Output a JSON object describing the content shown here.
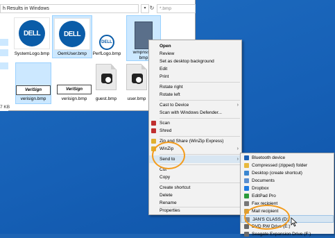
{
  "explorer": {
    "address": "h Results in Windows",
    "search_placeholder": "*.bmp",
    "status_text": "7 KB",
    "files": [
      {
        "name": "SystemLogo.bmp",
        "thumb": "dell-logo",
        "selected": false
      },
      {
        "name": "OemUser.bmp",
        "thumb": "dell-logo",
        "selected": true
      },
      {
        "name": "PerfLogo.bmp",
        "thumb": "dell-logo-small",
        "selected": false
      },
      {
        "name": "wmpnss_c",
        "name_line2": "bmp",
        "thumb": "media-image",
        "selected": true
      },
      {
        "name": "verisign.bmp",
        "thumb": "verisign-logo",
        "selected": true
      },
      {
        "name": "verisign.bmp",
        "thumb": "verisign-logo",
        "selected": false
      },
      {
        "name": "guest.bmp",
        "thumb": "camera-icon",
        "selected": false
      },
      {
        "name": "user.bmp",
        "thumb": "camera-icon",
        "selected": false
      }
    ]
  },
  "context_menu": {
    "items": [
      {
        "label": "Open",
        "bold": true
      },
      {
        "label": "Review"
      },
      {
        "label": "Set as desktop background"
      },
      {
        "label": "Edit"
      },
      {
        "label": "Print"
      },
      {
        "label": "Rotate right"
      },
      {
        "label": "Rotate left"
      },
      {
        "label": "Cast to Device",
        "submenu": true
      },
      {
        "label": "Scan with Windows Defender..."
      },
      {
        "label": "Scan",
        "icon": "scan-icon"
      },
      {
        "label": "Shred",
        "icon": "shred-icon"
      },
      {
        "label": "Zip and Share (WinZip Express)",
        "icon": "winzip-icon"
      },
      {
        "label": "WinZip",
        "icon": "winzip-icon",
        "submenu": true
      },
      {
        "label": "Send to",
        "submenu": true,
        "highlighted": true
      },
      {
        "label": "Cut"
      },
      {
        "label": "Copy"
      },
      {
        "label": "Create shortcut"
      },
      {
        "label": "Delete"
      },
      {
        "label": "Rename"
      },
      {
        "label": "Properties"
      }
    ]
  },
  "send_to_menu": {
    "items": [
      {
        "label": "Bluetooth device",
        "icon": "bluetooth-icon",
        "color": "#1a5fb4"
      },
      {
        "label": "Compressed (zipped) folder",
        "icon": "zip-folder-icon",
        "color": "#e8b83c"
      },
      {
        "label": "Desktop (create shortcut)",
        "icon": "desktop-icon",
        "color": "#3a86d0"
      },
      {
        "label": "Documents",
        "icon": "documents-icon",
        "color": "#5a8fd0"
      },
      {
        "label": "Dropbox",
        "icon": "dropbox-icon",
        "color": "#1e7ae0"
      },
      {
        "label": "EditPad Pro",
        "icon": "editpad-icon",
        "color": "#2a9a3a"
      },
      {
        "label": "Fax recipient",
        "icon": "fax-icon",
        "color": "#777777"
      },
      {
        "label": "Mail recipient",
        "icon": "mail-icon",
        "color": "#d0a040"
      },
      {
        "label": "JAN'S CLASS (D:)",
        "icon": "drive-icon",
        "color": "#8a8a8a",
        "highlighted": true
      },
      {
        "label": "DVD RW Drive (E:)",
        "icon": "dvd-drive-icon",
        "color": "#6a6a6a"
      },
      {
        "label": "Seagate Expansion Drive (F:)",
        "icon": "drive-icon",
        "color": "#6a6a6a"
      }
    ]
  },
  "colors": {
    "desktop": "#1660b6",
    "menu_bg": "#f2f2f2",
    "highlight": "#d8e6f2",
    "annotation": "#f39c1e"
  }
}
